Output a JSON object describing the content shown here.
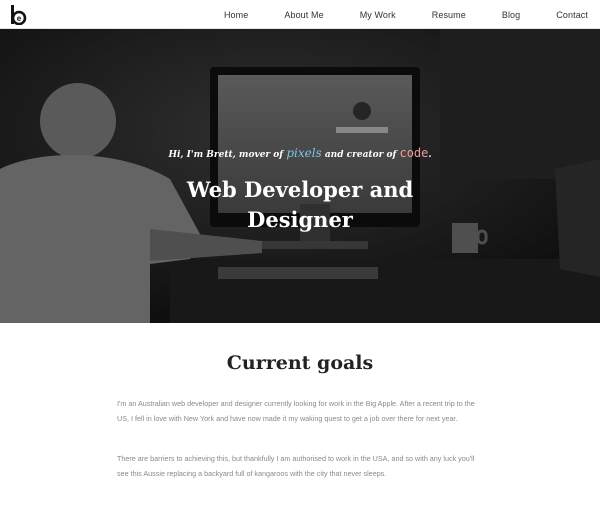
{
  "header": {
    "logo_icon": "be-logo-icon",
    "nav": [
      "Home",
      "About Me",
      "My Work",
      "Resume",
      "Blog",
      "Contact"
    ]
  },
  "hero": {
    "tagline_prefix": "Hi, I'm Brett, mover of ",
    "tagline_pixels": "pixels",
    "tagline_middle": " and creator of ",
    "tagline_code": "code",
    "tagline_suffix": ".",
    "title": "Web Developer and Designer",
    "background_description_icon": "hero-photo",
    "colors": {
      "pixels": "#7fc5e9",
      "code": "#f29a9a"
    }
  },
  "goals": {
    "heading": "Current goals",
    "paragraphs": [
      "I'm an Australian web developer and designer currently looking for work in the Big Apple. After a recent trip to the US, I fell in love with New York and have now made it my waking quest to get a job over there for next year.",
      "There are barriers to achieving this, but thankfully I am authorised to work in the USA, and so with any luck you'll see this Aussie replacing a backyard full of kangaroos with the city that never sleeps."
    ]
  }
}
